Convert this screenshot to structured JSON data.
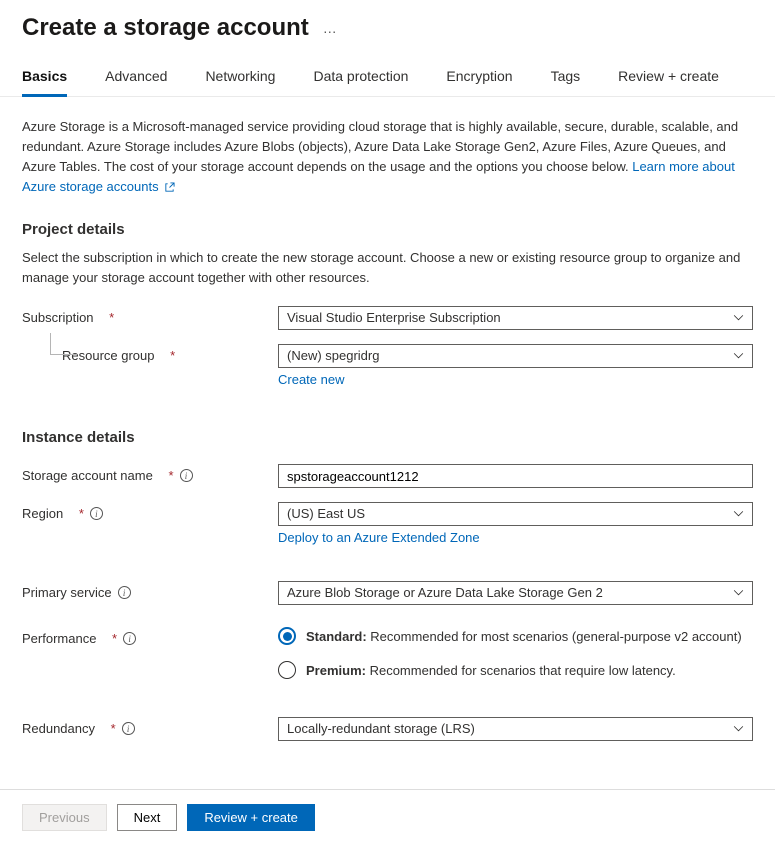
{
  "header": {
    "title": "Create a storage account"
  },
  "tabs": {
    "items": [
      {
        "label": "Basics",
        "active": true
      },
      {
        "label": "Advanced"
      },
      {
        "label": "Networking"
      },
      {
        "label": "Data protection"
      },
      {
        "label": "Encryption"
      },
      {
        "label": "Tags"
      },
      {
        "label": "Review + create"
      }
    ]
  },
  "intro": {
    "text": "Azure Storage is a Microsoft-managed service providing cloud storage that is highly available, secure, durable, scalable, and redundant. Azure Storage includes Azure Blobs (objects), Azure Data Lake Storage Gen2, Azure Files, Azure Queues, and Azure Tables. The cost of your storage account depends on the usage and the options you choose below. ",
    "link": "Learn more about Azure storage accounts"
  },
  "project": {
    "heading": "Project details",
    "desc": "Select the subscription in which to create the new storage account. Choose a new or existing resource group to organize and manage your storage account together with other resources.",
    "subscription_label": "Subscription",
    "subscription_value": "Visual Studio Enterprise Subscription",
    "rg_label": "Resource group",
    "rg_value": "(New) spegridrg",
    "create_new": "Create new"
  },
  "instance": {
    "heading": "Instance details",
    "name_label": "Storage account name",
    "name_value": "spstorageaccount1212",
    "region_label": "Region",
    "region_value": "(US) East US",
    "region_link": "Deploy to an Azure Extended Zone",
    "primary_label": "Primary service",
    "primary_value": "Azure Blob Storage or Azure Data Lake Storage Gen 2",
    "perf_label": "Performance",
    "perf_standard_bold": "Standard:",
    "perf_standard_rest": " Recommended for most scenarios (general-purpose v2 account)",
    "perf_premium_bold": "Premium:",
    "perf_premium_rest": " Recommended for scenarios that require low latency.",
    "redundancy_label": "Redundancy",
    "redundancy_value": "Locally-redundant storage (LRS)"
  },
  "footer": {
    "previous": "Previous",
    "next": "Next",
    "review": "Review + create"
  }
}
